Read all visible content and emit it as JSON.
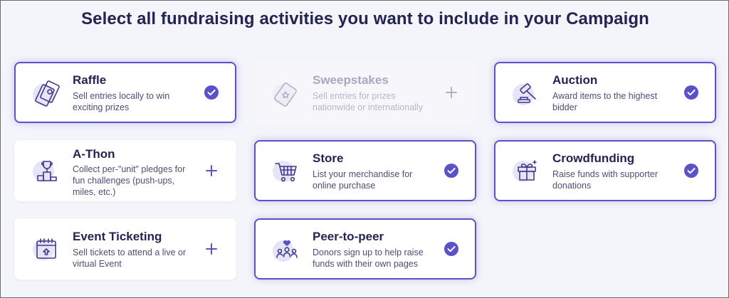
{
  "page": {
    "heading": "Select all fundraising activities you want to include in your Campaign"
  },
  "colors": {
    "accent": "#5a52c8",
    "heading": "#232452",
    "text": "#4c4f73",
    "icon": "#3d3a8c",
    "icon_blob": "#e6e4f7"
  },
  "activities": [
    {
      "key": "raffle",
      "title": "Raffle",
      "description": "Sell entries locally to win exciting prizes",
      "state": "selected",
      "icon": "raffle-tickets-icon"
    },
    {
      "key": "sweepstakes",
      "title": "Sweepstakes",
      "description": "Sell entries for prizes nationwide or internationally",
      "state": "disabled",
      "icon": "sweepstakes-ticket-icon"
    },
    {
      "key": "auction",
      "title": "Auction",
      "description": "Award items to the highest bidder",
      "state": "selected",
      "icon": "gavel-icon"
    },
    {
      "key": "athon",
      "title": "A-Thon",
      "description": "Collect per-\"unit\" pledges for fun challenges (push-ups, miles, etc.)",
      "state": "unselected",
      "icon": "trophy-podium-icon"
    },
    {
      "key": "store",
      "title": "Store",
      "description": "List your merchandise for online purchase",
      "state": "selected",
      "icon": "shopping-cart-icon"
    },
    {
      "key": "crowdfunding",
      "title": "Crowdfunding",
      "description": "Raise funds with supporter donations",
      "state": "selected",
      "icon": "gift-box-icon"
    },
    {
      "key": "ticketing",
      "title": "Event Ticketing",
      "description": "Sell tickets to attend a live or virtual Event",
      "state": "unselected",
      "icon": "event-calendar-icon"
    },
    {
      "key": "p2p",
      "title": "Peer-to-peer",
      "description": "Donors sign up to help raise funds with their own pages",
      "state": "selected",
      "icon": "people-group-icon"
    }
  ]
}
